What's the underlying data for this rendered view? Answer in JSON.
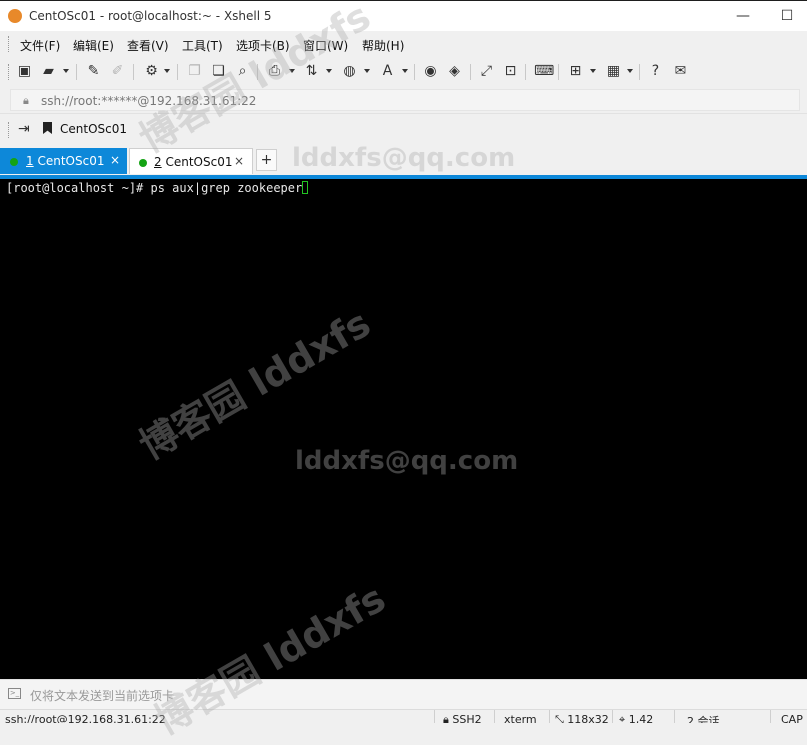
{
  "window": {
    "title": "CentOSc01 - root@localhost:~ - Xshell 5",
    "minimize_glyph": "—",
    "maximize_glyph": "☐"
  },
  "menu": {
    "items": [
      "文件(F)",
      "编辑(E)",
      "查看(V)",
      "工具(T)",
      "选项卡(B)",
      "窗口(W)",
      "帮助(H)"
    ]
  },
  "toolbar": {
    "icons": [
      "new-session-icon",
      "open-folder-icon",
      "reconnect-icon",
      "disconnect-icon",
      "properties-icon",
      "copy-icon",
      "paste-icon",
      "find-icon",
      "print-icon",
      "transfer-icon",
      "globe-icon",
      "font-icon",
      "xftp-icon",
      "xmanager-icon",
      "fullscreen-icon",
      "lock-icon",
      "keyboard-icon",
      "new-tab-icon",
      "layout-icon",
      "help-icon",
      "chat-icon"
    ]
  },
  "address": {
    "url": "ssh://root:******@192.168.31.61:22"
  },
  "links": {
    "session_label": "CentOSc01"
  },
  "tabs": [
    {
      "number": "1",
      "name": " CentOSc01",
      "status_color": "#14a314",
      "active": true
    },
    {
      "number": "2",
      "name": " CentOSc01",
      "status_color": "#14a314",
      "active": false
    }
  ],
  "tab_close_glyph": "×",
  "tab_add_glyph": "+",
  "terminal": {
    "prompt": "[root@localhost ~]# ",
    "command": "ps aux|grep zookeeper"
  },
  "send_bar": {
    "label": "仅将文本发送到当前选项卡"
  },
  "status": {
    "connection": "ssh://root@192.168.31.61:22",
    "protocol": "SSH2",
    "terminal_type": "xterm",
    "size": "118x32",
    "position": "1,42",
    "sessions": "2 会话",
    "caps": "CAP"
  },
  "watermarks": {
    "blog": "博客园 lddxfs",
    "email": "lddxfs@qq.com"
  },
  "colors": {
    "accent": "#0d88d9",
    "terminal_bg": "#000000",
    "terminal_fg": "#e8e8e8",
    "cursor": "#22c422",
    "session_dot": "#14a314"
  }
}
